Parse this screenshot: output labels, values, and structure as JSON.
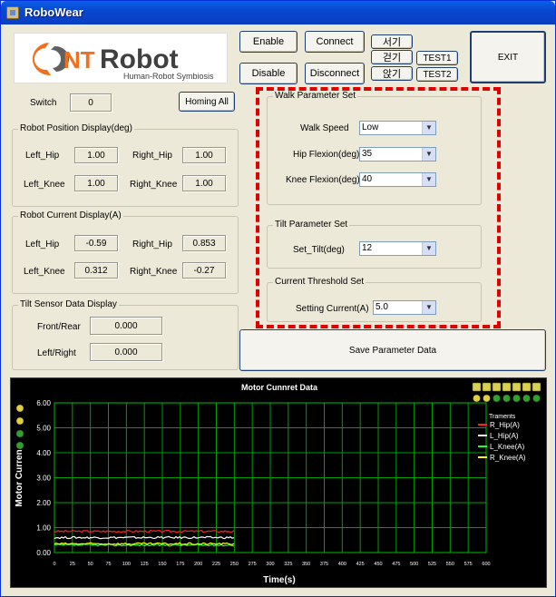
{
  "window": {
    "title": "RoboWear"
  },
  "logo": {
    "text_prefix": "NT",
    "text_main": "Robot",
    "tagline": "Human-Robot Symbiosis"
  },
  "controls": {
    "enable": "Enable",
    "disable": "Disable",
    "connect": "Connect",
    "disconnect": "Disconnect",
    "stand": "서기",
    "walk": "걷기",
    "sit": "앉기",
    "test1": "TEST1",
    "test2": "TEST2",
    "exit": "EXIT",
    "switch_label": "Switch",
    "switch_value": "0",
    "homing_all": "Homing All"
  },
  "position": {
    "title": "Robot Position Display(deg)",
    "left_hip_label": "Left_Hip",
    "left_hip": "1.00",
    "right_hip_label": "Right_Hip",
    "right_hip": "1.00",
    "left_knee_label": "Left_Knee",
    "left_knee": "1.00",
    "right_knee_label": "Right_Knee",
    "right_knee": "1.00"
  },
  "current": {
    "title": "Robot Current Display(A)",
    "left_hip_label": "Left_Hip",
    "left_hip": "-0.59",
    "right_hip_label": "Right_Hip",
    "right_hip": "0.853",
    "left_knee_label": "Left_Knee",
    "left_knee": "0.312",
    "right_knee_label": "Right_Knee",
    "right_knee": "-0.27"
  },
  "tilt_sensor": {
    "title": "Tilt Sensor Data Display",
    "front_rear_label": "Front/Rear",
    "front_rear": "0.000",
    "left_right_label": "Left/Right",
    "left_right": "0.000"
  },
  "walk_params": {
    "title": "Walk Parameter Set",
    "walk_speed_label": "Walk Speed",
    "walk_speed": "Low",
    "hip_flexion_label": "Hip Flexion(deg)",
    "hip_flexion": "35",
    "knee_flexion_label": "Knee Flexion(deg)",
    "knee_flexion": "40"
  },
  "tilt_params": {
    "title": "Tilt Parameter Set",
    "set_tilt_label": "Set_Tilt(deg)",
    "set_tilt": "12"
  },
  "current_threshold": {
    "title": "Current Threshold Set",
    "setting_current_label": "Setting Current(A)",
    "setting_current": "5.0"
  },
  "save_button": "Save Parameter Data",
  "chart_data": {
    "type": "line",
    "title": "Motor Cunnret  Data",
    "xlabel": "Time(s)",
    "ylabel": "Motor Curren",
    "xlim": [
      0,
      600
    ],
    "ylim": [
      0,
      6
    ],
    "x_ticks": [
      "0",
      "25",
      "50",
      "75",
      "100",
      "125",
      "150",
      "175",
      "200",
      "225",
      "250",
      "275",
      "300",
      "325",
      "350",
      "375",
      "400",
      "425",
      "450",
      "475",
      "500",
      "525",
      "550",
      "575",
      "600"
    ],
    "y_ticks": [
      "0.00",
      "1.00",
      "2.00",
      "3.00",
      "4.00",
      "5.00",
      "6.00"
    ],
    "legend_header": "Traments",
    "grid": true,
    "legend_position": "right",
    "series": [
      {
        "name": "R_Hip(A)",
        "color": "#ff2020",
        "level": 0.85,
        "x_end": 250
      },
      {
        "name": "L_Hip(A)",
        "color": "#ffffff",
        "level": 0.6,
        "x_end": 250
      },
      {
        "name": "L_Knee(A)",
        "color": "#20ff20",
        "level": 0.3,
        "x_end": 250
      },
      {
        "name": "R_Knee(A)",
        "color": "#ffff00",
        "level": 0.35,
        "x_end": 250
      }
    ]
  }
}
